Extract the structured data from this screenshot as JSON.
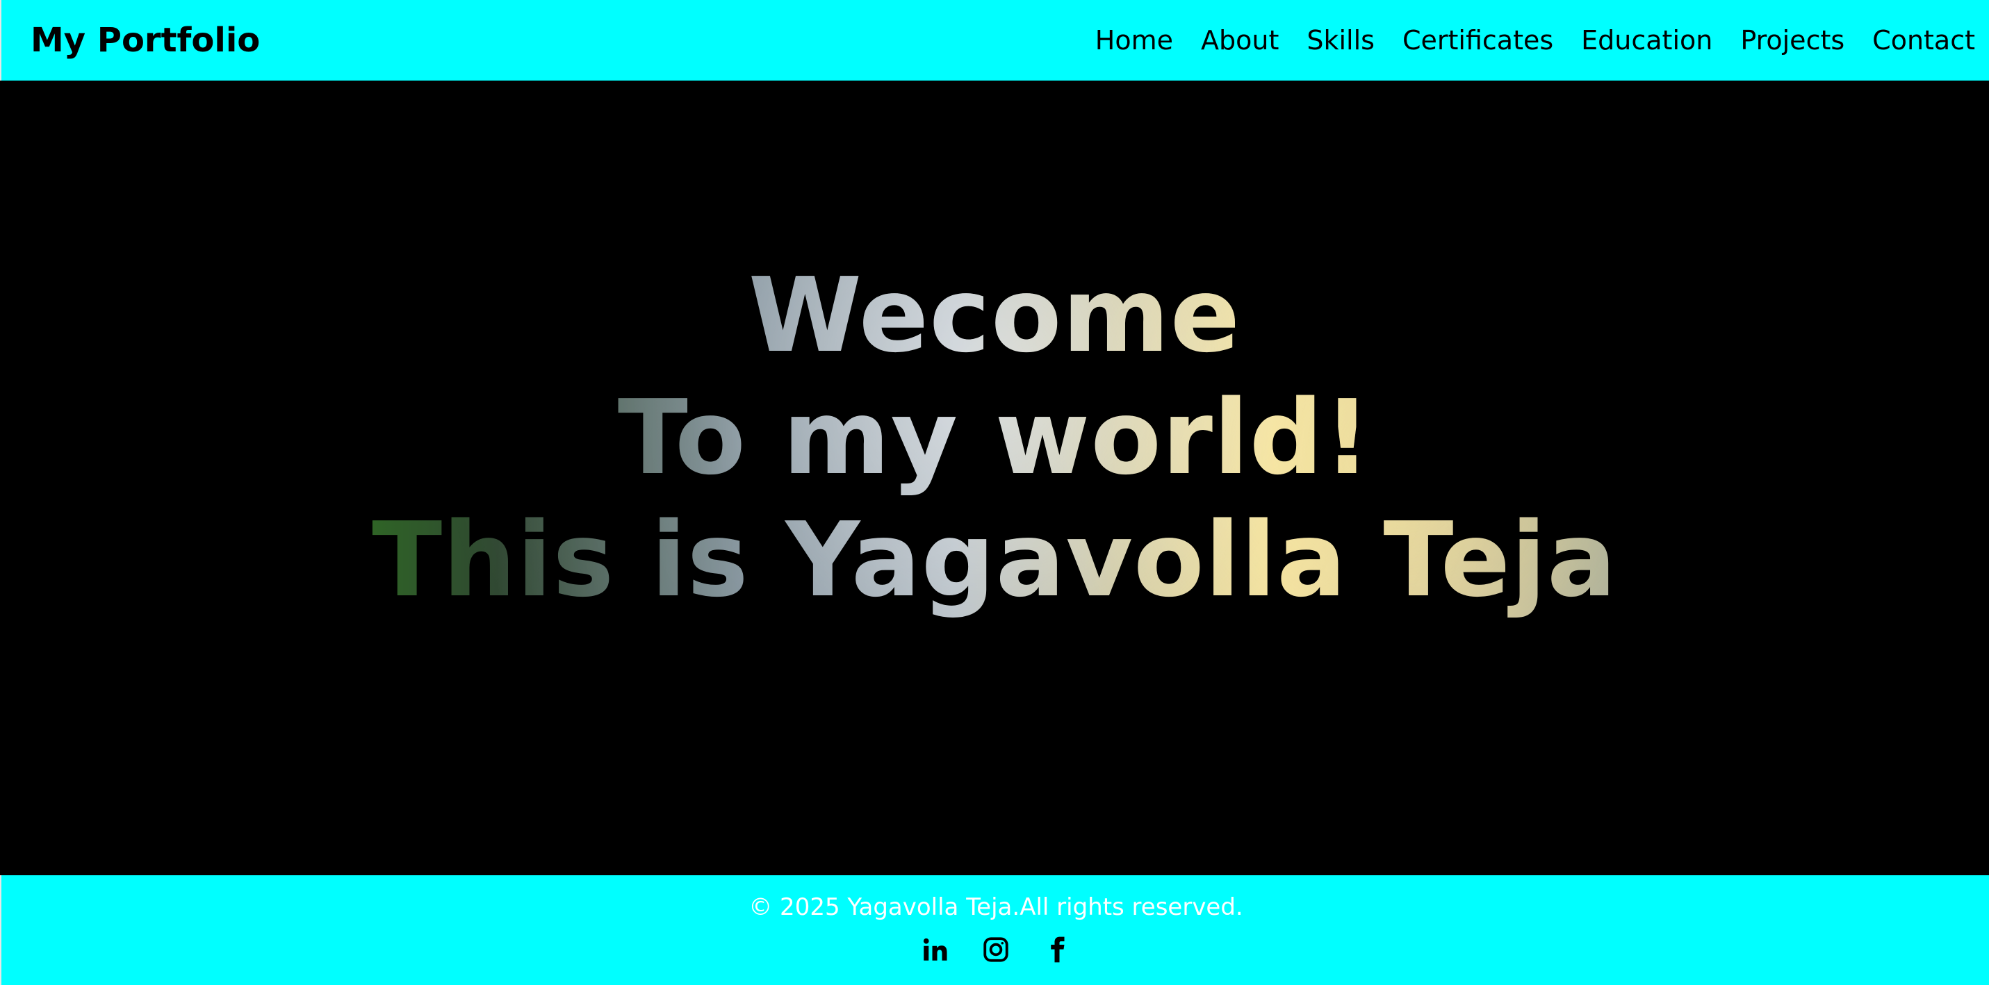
{
  "header": {
    "brand": "My Portfolio",
    "nav": [
      {
        "label": "Home"
      },
      {
        "label": "About"
      },
      {
        "label": "Skills"
      },
      {
        "label": "Certificates"
      },
      {
        "label": "Education"
      },
      {
        "label": "Projects"
      },
      {
        "label": "Contact"
      }
    ]
  },
  "hero": {
    "lines": [
      "Wecome",
      "To my world!",
      "This is Yagavolla Teja"
    ]
  },
  "footer": {
    "copyright": "© 2025 Yagavolla Teja.All rights reserved.",
    "socials": [
      {
        "icon": "linkedin-icon"
      },
      {
        "icon": "instagram-icon"
      },
      {
        "icon": "facebook-icon"
      }
    ]
  },
  "colors": {
    "header_background": "#00ffff",
    "footer_background": "#00ffff",
    "page_background": "#000000",
    "nav_text": "#000000",
    "footer_text": "#ffffff"
  }
}
